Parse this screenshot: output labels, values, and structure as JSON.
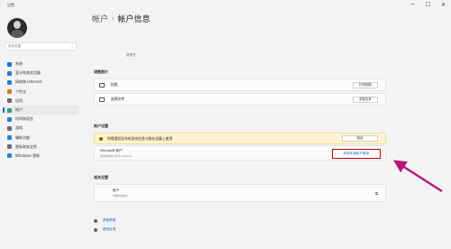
{
  "app": {
    "title": "设置"
  },
  "sidebar": {
    "search_placeholder": "查找设置",
    "items": [
      {
        "label": "系统",
        "color": "#0078d4"
      },
      {
        "label": "蓝牙和其他设备",
        "color": "#1f7ad6"
      },
      {
        "label": "网络和 Internet",
        "color": "#2d7fd2"
      },
      {
        "label": "个性化",
        "color": "#d97a1c"
      },
      {
        "label": "应用",
        "color": "#6b6b6b"
      },
      {
        "label": "帐户",
        "color": "#2ba26f",
        "active": true
      },
      {
        "label": "时间和语言",
        "color": "#2d7fd2"
      },
      {
        "label": "游戏",
        "color": "#6b6b6b"
      },
      {
        "label": "辅助功能",
        "color": "#2d7fd2"
      },
      {
        "label": "隐私和安全性",
        "color": "#6b6b6b"
      },
      {
        "label": "Windows 更新",
        "color": "#2d7fd2"
      }
    ]
  },
  "header": {
    "crumb1": "帐户",
    "separator": "›",
    "crumb2": "帐户信息"
  },
  "admin_label": "管理员",
  "adjust_photo": {
    "title": "调整照片",
    "rows": [
      {
        "label": "拍照",
        "button": "打开相机"
      },
      {
        "label": "选择文件",
        "button": "浏览文件"
      }
    ]
  },
  "account_settings": {
    "title": "帐户设置",
    "warning": {
      "text": "你需要验证你的身份信息才能在设备上使用",
      "button": "验证"
    },
    "microsoft": {
      "title": "Microsoft 帐户",
      "subtitle": "使用本地帐户登录 Windows",
      "button": "改用本地帐户登录"
    }
  },
  "related": {
    "title": "相关设置",
    "row": {
      "title": "帐户",
      "subtitle": "管理你的帐户"
    }
  },
  "links": [
    {
      "label": "获取帮助"
    },
    {
      "label": "提供反馈"
    }
  ]
}
